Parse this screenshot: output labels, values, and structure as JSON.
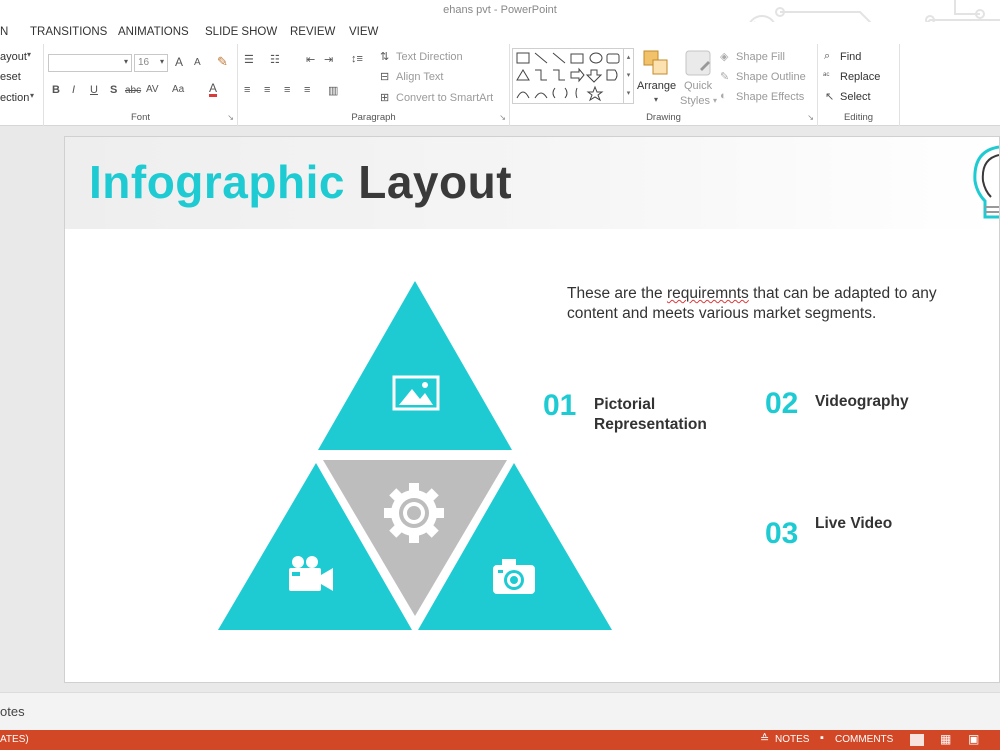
{
  "app": {
    "window_title": "ehans pvt - PowerPoint"
  },
  "menu": {
    "tabs": [
      "N",
      "TRANSITIONS",
      "ANIMATIONS",
      "SLIDE SHOW",
      "REVIEW",
      "VIEW"
    ]
  },
  "ribbon": {
    "slides": {
      "layout": "ayout",
      "reset": "eset",
      "section": "ection"
    },
    "font": {
      "label": "Font",
      "size": "16",
      "grow": "A",
      "shrink": "A",
      "bold": "B",
      "italic": "I",
      "underline": "U",
      "shadow": "S",
      "strike": "abc",
      "spacing": "AV",
      "case": "Aa",
      "color": "A"
    },
    "paragraph": {
      "label": "Paragraph",
      "text_direction": "Text Direction",
      "align_text": "Align Text",
      "convert_smartart": "Convert to SmartArt"
    },
    "drawing": {
      "label": "Drawing",
      "arrange": "Arrange",
      "quick_styles_1": "Quick",
      "quick_styles_2": "Styles",
      "shape_fill": "Shape Fill",
      "shape_outline": "Shape Outline",
      "shape_effects": "Shape Effects"
    },
    "editing": {
      "label": "Editing",
      "find": "Find",
      "replace": "Replace",
      "select": "Select"
    }
  },
  "slide": {
    "title_part1": "Infographic",
    "title_part2": "Layout",
    "description_before": "These are the ",
    "description_misspelled": "requiremnts",
    "description_after": " that can be adapted to any content and meets various market segments.",
    "items": [
      {
        "number": "01",
        "label_line1": "Pictorial",
        "label_line2": "Representation"
      },
      {
        "number": "02",
        "label_line1": "Videography"
      },
      {
        "number": "03",
        "label_line1": "Live Video"
      }
    ],
    "icons": [
      "picture-icon",
      "gear-icon",
      "video-camera-icon",
      "photo-camera-icon"
    ],
    "colors": {
      "accent": "#1ecbd2",
      "center_triangle": "#bdbdbd",
      "title_dark": "#3a3a3a"
    }
  },
  "notes_label": "otes",
  "status": {
    "left": "ATES)",
    "notes": "NOTES",
    "comments": "COMMENTS"
  }
}
